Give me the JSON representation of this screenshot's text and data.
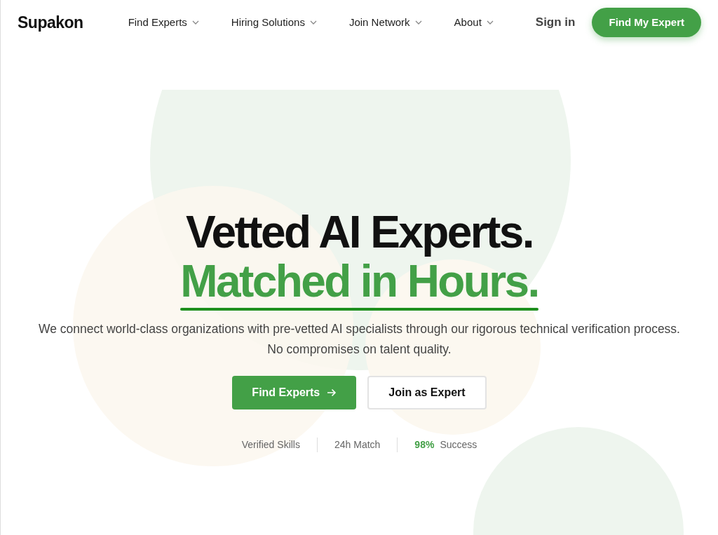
{
  "brand": "Supakon",
  "nav": [
    {
      "label": "Find Experts",
      "dropdown": true
    },
    {
      "label": "Hiring Solutions",
      "dropdown": true
    },
    {
      "label": "Join Network",
      "dropdown": true
    },
    {
      "label": "About",
      "dropdown": true
    }
  ],
  "sign_in": "Sign in",
  "cta": "Find My Expert",
  "hero": {
    "title_line_1": "Vetted AI Experts.",
    "title_line_2": "Matched in Hours.",
    "subtitle": "We connect world-class organizations with pre-vetted AI specialists through our rigorous technical verification process. No compromises on talent quality.",
    "primary_button": "Find Experts",
    "secondary_button": "Join as Expert",
    "stats": [
      {
        "text": "Verified Skills"
      },
      {
        "text": "24h Match"
      },
      {
        "highlight": "98%",
        "text": "Success"
      }
    ]
  }
}
